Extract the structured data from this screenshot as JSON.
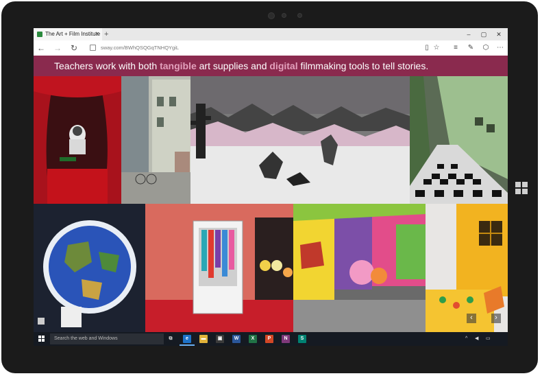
{
  "browser": {
    "tab_title": "The Art + Film Institute",
    "tab_close": "✕",
    "new_tab": "+",
    "window_controls": {
      "minimize": "–",
      "maximize": "▢",
      "close": "✕"
    },
    "back": "←",
    "forward": "→",
    "refresh": "↻",
    "url": "sway.com/BWhQSQGqTNHQYgiL",
    "toolbar_icons": [
      "reading-view-icon",
      "favorite-star-icon",
      "hub-icon",
      "web-note-icon",
      "share-icon",
      "more-icon"
    ],
    "toolbar_glyphs": {
      "reading": "▯",
      "star": "☆",
      "hub": "≡",
      "note": "✎",
      "share": "⬡",
      "more": "⋯"
    }
  },
  "banner": {
    "prefix": "Teachers work with both ",
    "highlight1": "tangible",
    "middle": " art supplies and ",
    "highlight2": "digital",
    "suffix": " filmmaking tools to tell stories."
  },
  "photos": [
    {
      "name": "puppet-theater-photo",
      "description_icon": "image"
    },
    {
      "name": "paper-street-photo",
      "description_icon": "image"
    },
    {
      "name": "desert-diorama-photo",
      "description_icon": "image"
    },
    {
      "name": "checkered-hallway-photo",
      "description_icon": "image"
    },
    {
      "name": "earth-collage-photo",
      "description_icon": "image"
    },
    {
      "name": "wardrobe-diorama-photo",
      "description_icon": "image"
    },
    {
      "name": "colorful-street-photo",
      "description_icon": "image"
    },
    {
      "name": "yellow-house-photo",
      "description_icon": "image"
    }
  ],
  "overlay": {
    "nav_prev": "‹",
    "nav_next": "›"
  },
  "taskbar": {
    "search_placeholder": "Search the web and Windows",
    "app_icons": [
      {
        "name": "task-view-icon",
        "glyph": "⧉",
        "color": "#151a22"
      },
      {
        "name": "edge-icon",
        "glyph": "e",
        "color": "#1e73c9"
      },
      {
        "name": "file-explorer-icon",
        "glyph": "▬",
        "color": "#e0b23a"
      },
      {
        "name": "store-icon",
        "glyph": "▣",
        "color": "#3b3b3b"
      },
      {
        "name": "word-icon",
        "glyph": "W",
        "color": "#2b579a"
      },
      {
        "name": "excel-icon",
        "glyph": "X",
        "color": "#217346"
      },
      {
        "name": "powerpoint-icon",
        "glyph": "P",
        "color": "#d24726"
      },
      {
        "name": "onenote-icon",
        "glyph": "N",
        "color": "#80397b"
      },
      {
        "name": "sway-icon",
        "glyph": "S",
        "color": "#008272"
      }
    ],
    "tray": {
      "chevron": "^",
      "volume": "◀",
      "notification": "▭"
    }
  },
  "colors": {
    "banner": "#8a2a4e",
    "highlight": "#e3a1bc",
    "taskbar": "#151a22"
  }
}
